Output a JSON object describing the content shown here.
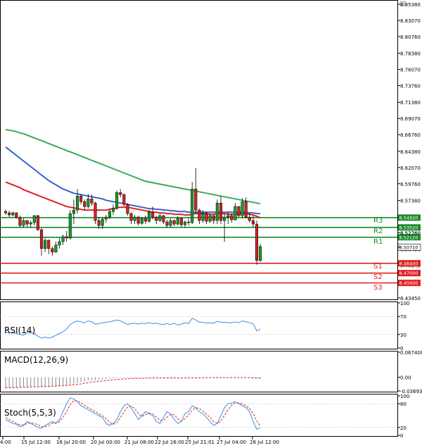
{
  "chart_data": [
    {
      "type": "candlestick",
      "y_ticks": [
        "8.85380",
        "8.83070",
        "8.80760",
        "8.78380",
        "8.76070",
        "8.73760",
        "8.71380",
        "8.69070",
        "8.66760",
        "8.64380",
        "8.62070",
        "8.59760",
        "8.57380",
        "8.55070",
        "8.52760",
        "8.50450",
        "8.48140",
        "8.45830",
        "8.43450"
      ],
      "ylim": [
        8.4345,
        8.8538
      ],
      "candles": [
        [
          8.558,
          8.561,
          8.553,
          8.556
        ],
        [
          8.556,
          8.559,
          8.55,
          8.553
        ],
        [
          8.553,
          8.558,
          8.551,
          8.556
        ],
        [
          8.556,
          8.557,
          8.548,
          8.549
        ],
        [
          8.549,
          8.552,
          8.535,
          8.538
        ],
        [
          8.538,
          8.548,
          8.535,
          8.545
        ],
        [
          8.545,
          8.546,
          8.536,
          8.54
        ],
        [
          8.54,
          8.545,
          8.535,
          8.542
        ],
        [
          8.542,
          8.553,
          8.538,
          8.552
        ],
        [
          8.552,
          8.553,
          8.53,
          8.532
        ],
        [
          8.532,
          8.534,
          8.495,
          8.505
        ],
        [
          8.505,
          8.52,
          8.5,
          8.517
        ],
        [
          8.517,
          8.518,
          8.497,
          8.505
        ],
        [
          8.505,
          8.508,
          8.495,
          8.5
        ],
        [
          8.5,
          8.515,
          8.499,
          8.51
        ],
        [
          8.51,
          8.52,
          8.505,
          8.515
        ],
        [
          8.515,
          8.525,
          8.51,
          8.522
        ],
        [
          8.522,
          8.53,
          8.515,
          8.52
        ],
        [
          8.52,
          8.56,
          8.518,
          8.555
        ],
        [
          8.555,
          8.575,
          8.54,
          8.56
        ],
        [
          8.56,
          8.59,
          8.555,
          8.58
        ],
        [
          8.58,
          8.583,
          8.568,
          8.572
        ],
        [
          8.572,
          8.575,
          8.56,
          8.565
        ],
        [
          8.565,
          8.583,
          8.562,
          8.576
        ],
        [
          8.576,
          8.582,
          8.566,
          8.57
        ],
        [
          8.57,
          8.572,
          8.54,
          8.545
        ],
        [
          8.545,
          8.55,
          8.533,
          8.538
        ],
        [
          8.538,
          8.55,
          8.533,
          8.547
        ],
        [
          8.547,
          8.553,
          8.542,
          8.55
        ],
        [
          8.55,
          8.562,
          8.547,
          8.558
        ],
        [
          8.558,
          8.568,
          8.553,
          8.563
        ],
        [
          8.563,
          8.588,
          8.56,
          8.585
        ],
        [
          8.585,
          8.59,
          8.578,
          8.582
        ],
        [
          8.582,
          8.584,
          8.565,
          8.568
        ],
        [
          8.568,
          8.57,
          8.552,
          8.555
        ],
        [
          8.555,
          8.557,
          8.54,
          8.545
        ],
        [
          8.545,
          8.553,
          8.54,
          8.55
        ],
        [
          8.55,
          8.552,
          8.538,
          8.541
        ],
        [
          8.541,
          8.55,
          8.539,
          8.548
        ],
        [
          8.548,
          8.552,
          8.54,
          8.544
        ],
        [
          8.544,
          8.56,
          8.542,
          8.557
        ],
        [
          8.557,
          8.565,
          8.547,
          8.55
        ],
        [
          8.55,
          8.552,
          8.54,
          8.545
        ],
        [
          8.545,
          8.555,
          8.543,
          8.552
        ],
        [
          8.552,
          8.553,
          8.54,
          8.543
        ],
        [
          8.543,
          8.546,
          8.535,
          8.538
        ],
        [
          8.538,
          8.548,
          8.535,
          8.545
        ],
        [
          8.545,
          8.547,
          8.537,
          8.54
        ],
        [
          8.54,
          8.551,
          8.538,
          8.548
        ],
        [
          8.548,
          8.55,
          8.536,
          8.539
        ],
        [
          8.539,
          8.545,
          8.535,
          8.543
        ],
        [
          8.543,
          8.548,
          8.538,
          8.542
        ],
        [
          8.542,
          8.6,
          8.54,
          8.59
        ],
        [
          8.59,
          8.62,
          8.555,
          8.56
        ],
        [
          8.56,
          8.562,
          8.54,
          8.545
        ],
        [
          8.545,
          8.56,
          8.542,
          8.555
        ],
        [
          8.555,
          8.557,
          8.54,
          8.544
        ],
        [
          8.544,
          8.555,
          8.542,
          8.552
        ],
        [
          8.552,
          8.553,
          8.54,
          8.545
        ],
        [
          8.545,
          8.575,
          8.54,
          8.57
        ],
        [
          8.57,
          8.58,
          8.54,
          8.545
        ],
        [
          8.545,
          8.555,
          8.515,
          8.55
        ],
        [
          8.55,
          8.558,
          8.54,
          8.552
        ],
        [
          8.552,
          8.555,
          8.542,
          8.546
        ],
        [
          8.546,
          8.57,
          8.545,
          8.565
        ],
        [
          8.565,
          8.566,
          8.55,
          8.552
        ],
        [
          8.552,
          8.577,
          8.548,
          8.572
        ],
        [
          8.572,
          8.578,
          8.548,
          8.55
        ],
        [
          8.55,
          8.555,
          8.542,
          8.545
        ],
        [
          8.545,
          8.552,
          8.535,
          8.54
        ],
        [
          8.54,
          8.545,
          8.482,
          8.488
        ],
        [
          8.488,
          8.512,
          8.486,
          8.508
        ]
      ],
      "moving_averages": [
        {
          "name": "ma-fast",
          "color": "#e02020",
          "values": [
            8.6,
            8.598,
            8.596,
            8.594,
            8.592,
            8.589,
            8.587,
            8.585,
            8.583,
            8.581,
            8.579,
            8.577,
            8.575,
            8.573,
            8.571,
            8.569,
            8.567,
            8.565,
            8.564,
            8.563,
            8.562,
            8.561,
            8.56,
            8.56,
            8.56,
            8.56,
            8.56,
            8.56,
            8.56,
            8.561,
            8.562,
            8.563,
            8.564,
            8.564,
            8.564,
            8.563,
            8.562,
            8.561,
            8.56,
            8.559,
            8.558,
            8.557,
            8.557,
            8.556,
            8.556,
            8.555,
            8.555,
            8.554,
            8.554,
            8.554,
            8.553,
            8.553,
            8.554,
            8.555,
            8.555,
            8.555,
            8.555,
            8.554,
            8.554,
            8.555,
            8.555,
            8.555,
            8.554,
            8.554,
            8.554,
            8.554,
            8.555,
            8.555,
            8.554,
            8.553,
            8.551,
            8.549
          ]
        },
        {
          "name": "ma-mid",
          "color": "#3a5fcd",
          "values": [
            8.65,
            8.646,
            8.642,
            8.638,
            8.634,
            8.63,
            8.626,
            8.622,
            8.618,
            8.614,
            8.61,
            8.606,
            8.602,
            8.599,
            8.596,
            8.593,
            8.59,
            8.588,
            8.586,
            8.584,
            8.583,
            8.582,
            8.581,
            8.58,
            8.579,
            8.578,
            8.577,
            8.576,
            8.574,
            8.573,
            8.572,
            8.571,
            8.57,
            8.569,
            8.568,
            8.567,
            8.566,
            8.565,
            8.564,
            8.563,
            8.562,
            8.562,
            8.561,
            8.561,
            8.56,
            8.56,
            8.559,
            8.559,
            8.558,
            8.558,
            8.558,
            8.557,
            8.557,
            8.557,
            8.557,
            8.557,
            8.557,
            8.557,
            8.557,
            8.557,
            8.557,
            8.557,
            8.557,
            8.557,
            8.557,
            8.557,
            8.557,
            8.557,
            8.556,
            8.556,
            8.555,
            8.555
          ]
        },
        {
          "name": "ma-slow",
          "color": "#3aaa5a",
          "values": [
            8.675,
            8.674,
            8.673,
            8.672,
            8.67,
            8.669,
            8.667,
            8.665,
            8.663,
            8.661,
            8.659,
            8.657,
            8.655,
            8.653,
            8.651,
            8.649,
            8.647,
            8.645,
            8.643,
            8.641,
            8.639,
            8.637,
            8.635,
            8.633,
            8.631,
            8.629,
            8.627,
            8.625,
            8.623,
            8.621,
            8.619,
            8.617,
            8.615,
            8.613,
            8.611,
            8.609,
            8.607,
            8.605,
            8.603,
            8.601,
            8.6,
            8.599,
            8.598,
            8.597,
            8.596,
            8.595,
            8.594,
            8.593,
            8.592,
            8.591,
            8.59,
            8.589,
            8.588,
            8.587,
            8.586,
            8.585,
            8.584,
            8.583,
            8.582,
            8.581,
            8.58,
            8.579,
            8.578,
            8.577,
            8.576,
            8.575,
            8.574,
            8.573,
            8.572,
            8.571,
            8.57,
            8.569
          ]
        }
      ],
      "levels": [
        {
          "label": "R3",
          "value_label": "8.54920",
          "value": 8.5492,
          "color": "#1a8a2a"
        },
        {
          "label": "R2",
          "value_label": "8.53520",
          "value": 8.5352,
          "color": "#1a8a2a"
        },
        {
          "label": "R1",
          "value_label": "8.52120",
          "value": 8.5212,
          "color": "#1a8a2a"
        },
        {
          "label": "S1",
          "value_label": "8.48400",
          "value": 8.484,
          "color": "#e02020"
        },
        {
          "label": "S2",
          "value_label": "8.47000",
          "value": 8.47,
          "color": "#e02020"
        },
        {
          "label": "S3",
          "value_label": "8.45600",
          "value": 8.456,
          "color": "#e02020"
        }
      ],
      "level_label_order": [
        "R3",
        "R2",
        "R1",
        "S1",
        "S2",
        "S3"
      ],
      "extra_price_labels": [
        {
          "text": "8.52760",
          "value": 8.5276
        }
      ],
      "current_price": {
        "value_label": "8.50710",
        "value": 8.5071
      }
    },
    {
      "type": "line",
      "name": "RSI(14)",
      "y_ticks": [
        "100",
        "70",
        "30",
        "0"
      ],
      "ylim": [
        0,
        100
      ],
      "color": "#3a8ee6",
      "values": [
        35,
        33,
        35,
        32,
        30,
        28,
        34,
        34,
        32,
        26,
        22,
        24,
        22,
        24,
        28,
        32,
        36,
        42,
        52,
        57,
        60,
        58,
        56,
        60,
        58,
        53,
        54,
        56,
        57,
        58,
        60,
        62,
        60,
        56,
        52,
        54,
        55,
        53,
        55,
        54,
        56,
        54,
        55,
        53,
        52,
        54,
        52,
        55,
        51,
        53,
        56,
        54,
        66,
        62,
        57,
        57,
        55,
        56,
        55,
        59,
        57,
        57,
        56,
        56,
        58,
        56,
        60,
        58,
        56,
        54,
        38,
        42
      ]
    },
    {
      "type": "histogram",
      "name": "MACD(12,26,9)",
      "y_ticks": [
        "0.067408",
        "0.00",
        "-0.036931"
      ],
      "ylim": [
        -0.036931,
        0.067408
      ],
      "color": "#888888",
      "signal_color": "#e02020",
      "histogram": [
        -0.03,
        -0.029,
        -0.029,
        -0.028,
        -0.028,
        -0.027,
        -0.027,
        -0.026,
        -0.026,
        -0.026,
        -0.026,
        -0.025,
        -0.025,
        -0.024,
        -0.024,
        -0.023,
        -0.022,
        -0.021,
        -0.019,
        -0.017,
        -0.015,
        -0.013,
        -0.012,
        -0.01,
        -0.009,
        -0.008,
        -0.007,
        -0.006,
        -0.005,
        -0.004,
        -0.003,
        -0.002,
        -0.002,
        -0.002,
        -0.002,
        -0.002,
        -0.002,
        -0.002,
        -0.002,
        -0.002,
        -0.002,
        -0.002,
        -0.002,
        -0.002,
        -0.002,
        -0.002,
        -0.002,
        -0.002,
        -0.002,
        -0.002,
        -0.002,
        -0.002,
        -0.001,
        -0.001,
        -0.001,
        -0.001,
        -0.001,
        -0.001,
        -0.001,
        -0.001,
        -0.001,
        -0.001,
        -0.001,
        -0.001,
        -0.001,
        -0.001,
        -0.001,
        -0.001,
        -0.002,
        -0.002,
        -0.003,
        -0.004
      ],
      "signal": [
        -0.028,
        -0.028,
        -0.028,
        -0.028,
        -0.027,
        -0.027,
        -0.027,
        -0.026,
        -0.026,
        -0.026,
        -0.025,
        -0.025,
        -0.025,
        -0.024,
        -0.024,
        -0.023,
        -0.023,
        -0.022,
        -0.021,
        -0.02,
        -0.019,
        -0.018,
        -0.016,
        -0.015,
        -0.013,
        -0.012,
        -0.011,
        -0.01,
        -0.009,
        -0.008,
        -0.007,
        -0.006,
        -0.005,
        -0.005,
        -0.004,
        -0.004,
        -0.003,
        -0.003,
        -0.003,
        -0.003,
        -0.002,
        -0.002,
        -0.002,
        -0.002,
        -0.002,
        -0.002,
        -0.002,
        -0.002,
        -0.002,
        -0.002,
        -0.002,
        -0.002,
        -0.002,
        -0.002,
        -0.002,
        -0.002,
        -0.001,
        -0.001,
        -0.001,
        -0.001,
        -0.001,
        -0.001,
        -0.001,
        -0.001,
        -0.001,
        -0.001,
        -0.001,
        -0.001,
        -0.001,
        -0.002,
        -0.002,
        -0.002
      ]
    },
    {
      "type": "line",
      "name": "Stoch(5,5,3)",
      "y_ticks": [
        "100",
        "80",
        "20",
        "0"
      ],
      "ylim": [
        0,
        100
      ],
      "series": [
        {
          "color": "#3a8ee6",
          "values": [
            40,
            35,
            30,
            28,
            22,
            25,
            35,
            30,
            25,
            20,
            18,
            25,
            30,
            35,
            30,
            40,
            60,
            80,
            95,
            92,
            85,
            75,
            70,
            65,
            60,
            55,
            50,
            45,
            30,
            25,
            30,
            40,
            60,
            75,
            80,
            70,
            55,
            40,
            50,
            60,
            55,
            50,
            35,
            30,
            45,
            60,
            55,
            40,
            30,
            35,
            55,
            60,
            75,
            70,
            60,
            55,
            45,
            35,
            25,
            30,
            50,
            70,
            80,
            82,
            85,
            80,
            75,
            70,
            60,
            35,
            15,
            20
          ]
        },
        {
          "color": "#e02020",
          "values": [
            45,
            40,
            35,
            30,
            27,
            26,
            30,
            32,
            30,
            27,
            22,
            22,
            25,
            30,
            32,
            34,
            45,
            60,
            78,
            88,
            88,
            82,
            76,
            70,
            65,
            60,
            55,
            50,
            42,
            33,
            28,
            32,
            45,
            60,
            72,
            74,
            68,
            55,
            48,
            52,
            56,
            54,
            46,
            38,
            38,
            46,
            53,
            52,
            42,
            36,
            42,
            52,
            63,
            70,
            68,
            62,
            53,
            45,
            35,
            30,
            36,
            50,
            65,
            76,
            82,
            82,
            80,
            75,
            68,
            55,
            37,
            23
          ]
        }
      ]
    }
  ],
  "x_axis": {
    "ticks": [
      "4:00",
      "15 Jul 12:00",
      "16 Jul 20:00",
      "20 Jul 00:00",
      "21 Jul 08:00",
      "22 Jul 16:00",
      "25 Jul 21:01",
      "27 Jul 04:00",
      "28 Jul 12:00"
    ]
  }
}
